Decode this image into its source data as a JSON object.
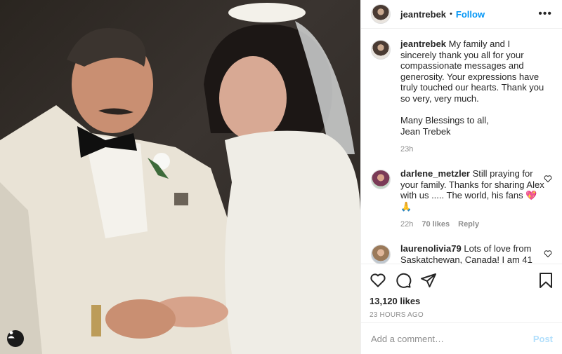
{
  "header": {
    "username": "jeantrebek",
    "dot": "•",
    "follow": "Follow",
    "more": "•••"
  },
  "caption": {
    "username": "jeantrebek",
    "text": "My family and I sincerely thank you all for your compassionate messages and generosity. Your expressions have truly touched our hearts. Thank you so very, very much.\n\nMany Blessings to all,\nJean Trebek",
    "time": "23h"
  },
  "comments": [
    {
      "username": "darlene_metzler",
      "text": "Still praying for your family. Thanks for sharing Alex with us ..... The world, his fans 💖🙏",
      "time": "22h",
      "likes": "70 likes",
      "reply": "Reply"
    },
    {
      "username": "laurenolivia79",
      "text": "Lots of love from Saskatchewan, Canada! I am 41"
    }
  ],
  "likes": "13,120 likes",
  "timestamp": "23 HOURS AGO",
  "add_comment": {
    "placeholder": "Add a comment…",
    "post": "Post"
  },
  "icons": [
    "heart-icon",
    "comment-icon",
    "share-icon",
    "bookmark-icon",
    "more-icon",
    "user-tag-icon"
  ]
}
